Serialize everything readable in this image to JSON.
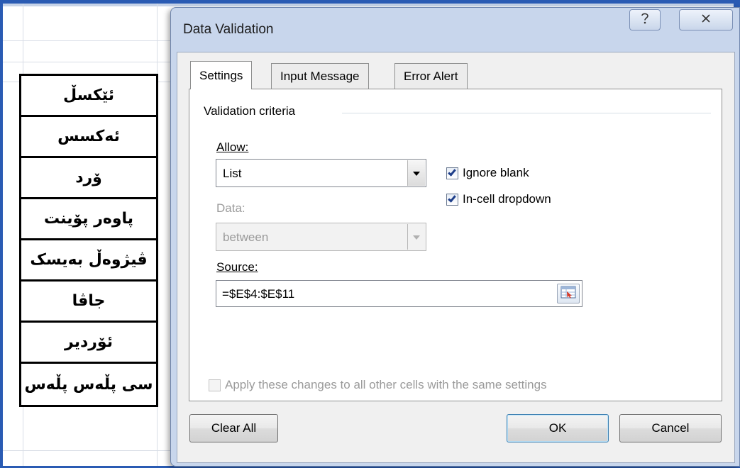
{
  "spreadsheet": {
    "list_cells": [
      "ئێکسڵ",
      "ئەکسس",
      "ۆرد",
      "پاوەر پۆینت",
      "ڤیژوەڵ بەیسک",
      "جاڤا",
      "ئۆردیر",
      "سی پڵەس پڵەس"
    ]
  },
  "dialog": {
    "title": "Data Validation",
    "help_icon": "help-icon",
    "close_icon": "close-icon",
    "tabs": [
      {
        "label": "Settings",
        "active": true
      },
      {
        "label": "Input Message",
        "active": false
      },
      {
        "label": "Error Alert",
        "active": false
      }
    ],
    "criteria_label": "Validation criteria",
    "allow": {
      "label": "Allow:",
      "value": "List"
    },
    "data": {
      "label": "Data:",
      "value": "between",
      "disabled": true
    },
    "ignore_blank": {
      "label": "Ignore blank",
      "checked": true
    },
    "incell_dropdown": {
      "label": "In-cell dropdown",
      "checked": true
    },
    "source": {
      "label": "Source:",
      "value": "=$E$4:$E$11",
      "picker_icon": "range-select-icon"
    },
    "apply_all": {
      "label": "Apply these changes to all other cells with the same settings",
      "checked": false,
      "disabled": true
    },
    "buttons": {
      "clear_all": "Clear All",
      "ok": "OK",
      "cancel": "Cancel"
    },
    "accent_color": "#3c7fb1"
  }
}
